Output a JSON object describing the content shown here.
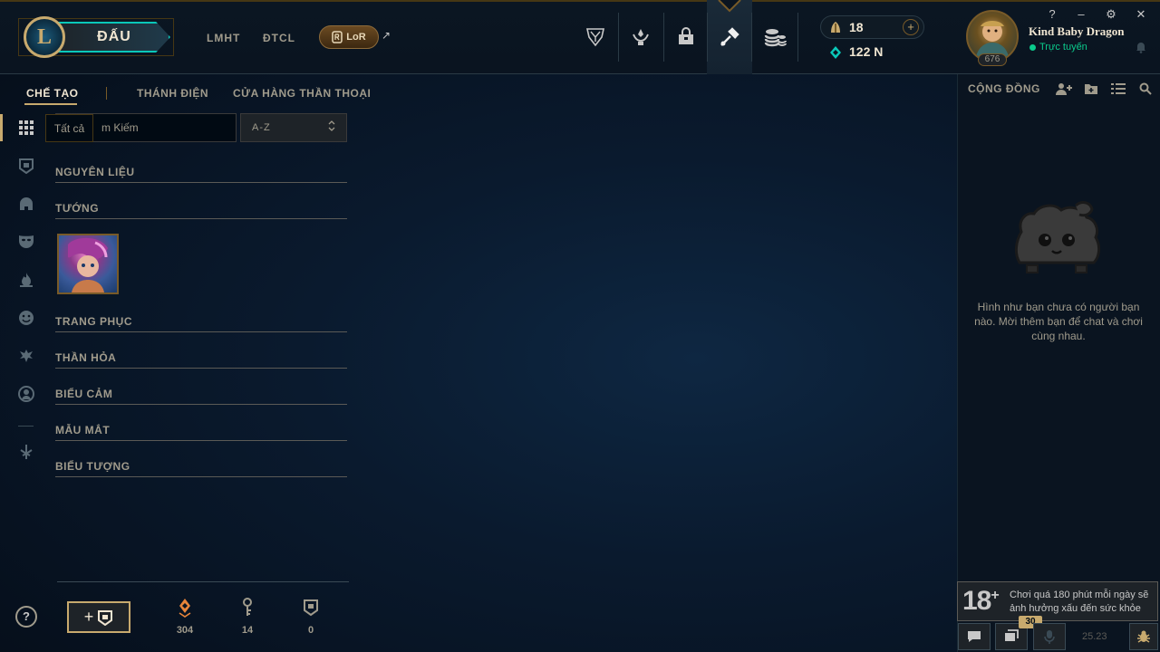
{
  "header": {
    "logo_letter": "L",
    "play_label": "ĐẤU",
    "nav_links": [
      "LMHT",
      "ĐTCL"
    ],
    "lor_label": "LoR",
    "lor_arrow": "↗",
    "icons": [
      "trophy-icon",
      "tft-icon",
      "store-bag-icon",
      "crafting-icon",
      "coins-icon"
    ],
    "currency": {
      "be": "18",
      "rp": "122 N",
      "plus": "+"
    },
    "profile": {
      "name": "Kind Baby Dragon",
      "status": "Trực tuyến",
      "level": "676"
    },
    "window_controls": [
      "?",
      "–",
      "⚙",
      "✕"
    ]
  },
  "subnav": {
    "tabs": [
      "CHẾ TẠO",
      "THÁNH ĐIỆN",
      "CỬA HÀNG THẦN THOẠI"
    ]
  },
  "filters": {
    "tooltip": "Tất cả",
    "search_placeholder": "m Kiếm",
    "sort_value": "A-Z"
  },
  "sections": [
    "NGUYÊN LIỆU",
    "TƯỚNG",
    "TRANG PHỤC",
    "THẦN HỎA",
    "BIỂU CẢM",
    "MẪU MẮT",
    "BIỂU TƯỢNG"
  ],
  "bottom": {
    "help": "?",
    "add_plus": "+",
    "loot_counts": [
      "304",
      "14",
      "0"
    ]
  },
  "social": {
    "title": "CỘNG ĐỒNG",
    "empty_message": "Hình như bạn chưa có người bạn nào. Mời thêm bạn để chat và chơi cùng nhau.",
    "age_rating": "18",
    "age_plus": "+",
    "age_warning": "Chơi quá 180 phút mỗi ngày sẽ ảnh hưởng xấu đến sức khỏe",
    "badge_count": "30",
    "version": "25.23"
  },
  "colors": {
    "gold": "#c8aa6e",
    "teal": "#0ac8b9",
    "online": "#0acb8c",
    "background": "#0a1a2e"
  }
}
